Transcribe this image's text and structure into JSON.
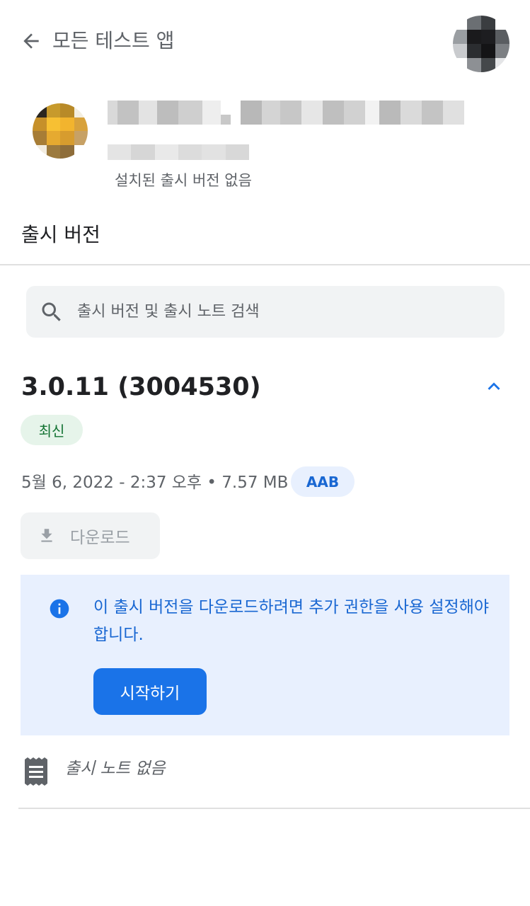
{
  "header": {
    "back_icon": "arrow-back-icon",
    "title": "모든 테스트 앱",
    "avatar": "account-avatar"
  },
  "app": {
    "name": "",
    "package": "",
    "install_status": "설치된 출시 버전 없음"
  },
  "section": {
    "title": "출시 버전"
  },
  "search": {
    "icon": "search-icon",
    "placeholder": "출시 버전 및 출시 노트 검색"
  },
  "release": {
    "version": "3.0.11 (3004530)",
    "latest_badge": "최신",
    "meta": "5월 6, 2022 - 2:37 오후 • 7.57 MB",
    "format_badge": "AAB",
    "download_label": "다운로드",
    "collapse_icon": "chevron-up-icon",
    "info": {
      "message": "이 출시 버전을 다운로드하려면 추가 권한을 사용 설정해야 합니다.",
      "button_label": "시작하기"
    },
    "notes_text": "출시 노트 없음"
  },
  "colors": {
    "accent": "#1a73e8",
    "accent_text": "#1967d2",
    "info_bg": "#e8f0fe",
    "latest_bg": "#e6f4ea",
    "latest_text": "#137333"
  }
}
